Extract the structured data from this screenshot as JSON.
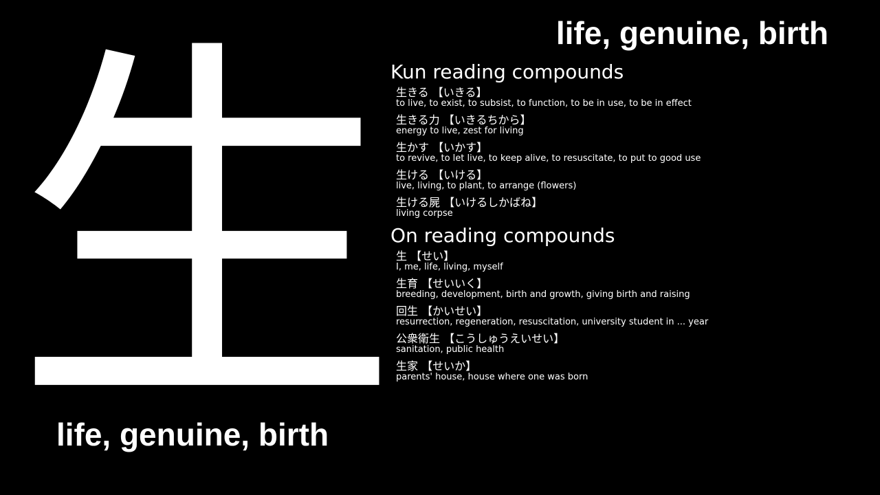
{
  "kanji": "生",
  "meaning": "life, genuine, birth",
  "kun": {
    "title": "Kun reading compounds",
    "entries": [
      {
        "word": "生きる",
        "reading": "【いきる】",
        "gloss": "to live, to exist, to subsist, to function, to be in use, to be in effect"
      },
      {
        "word": "生きる力",
        "reading": "【いきるちから】",
        "gloss": "energy to live, zest for living"
      },
      {
        "word": "生かす",
        "reading": "【いかす】",
        "gloss": "to revive, to let live, to keep alive, to resuscitate, to put to good use"
      },
      {
        "word": "生ける",
        "reading": "【いける】",
        "gloss": "live, living, to plant, to arrange (flowers)"
      },
      {
        "word": "生ける屍",
        "reading": "【いけるしかばね】",
        "gloss": "living corpse"
      }
    ]
  },
  "on": {
    "title": "On reading compounds",
    "entries": [
      {
        "word": "生",
        "reading": "【せい】",
        "gloss": "I, me, life, living, myself"
      },
      {
        "word": "生育",
        "reading": "【せいいく】",
        "gloss": "breeding, development, birth and growth, giving birth and raising"
      },
      {
        "word": "回生",
        "reading": "【かいせい】",
        "gloss": "resurrection, regeneration, resuscitation, university student in ... year"
      },
      {
        "word": "公衆衛生",
        "reading": "【こうしゅうえいせい】",
        "gloss": "sanitation, public health"
      },
      {
        "word": "生家",
        "reading": "【せいか】",
        "gloss": "parents' house, house where one was born"
      }
    ]
  }
}
